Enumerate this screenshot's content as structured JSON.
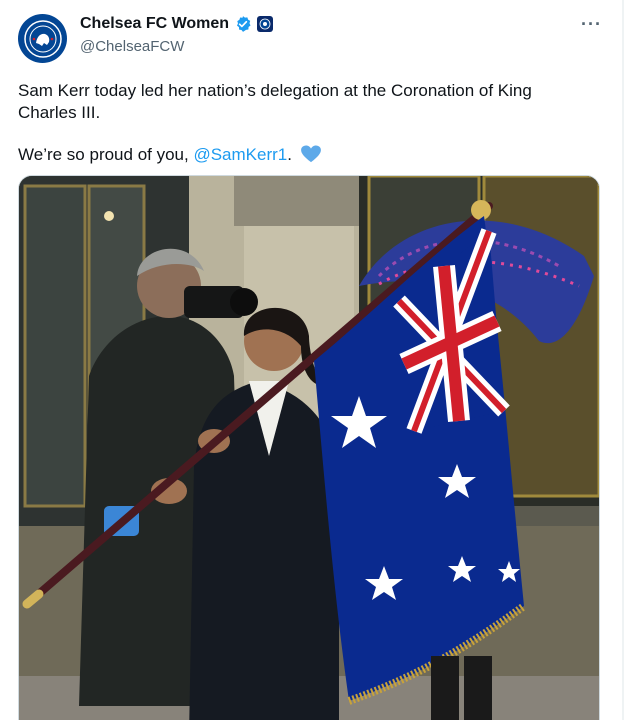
{
  "author": {
    "name": "Chelsea FC Women",
    "handle": "@ChelseaFCW",
    "verified_color": "#1d9bf0"
  },
  "tweet": {
    "text_line1": "Sam Kerr today led her nation’s delegation at the Coronation of King Charles III.",
    "text_line2_prefix": "We’re so proud of you, ",
    "mention": "@SamKerr1",
    "text_line2_suffix": ".",
    "emoji": "blue-heart-icon"
  },
  "menu": {
    "more_label": "···"
  },
  "colors": {
    "link": "#1d9bf0",
    "text": "#0f1419",
    "secondary": "#536471",
    "chelsea_blue": "#034694",
    "flag_blue": "#0a2a8f",
    "flag_red": "#d21f2b"
  }
}
